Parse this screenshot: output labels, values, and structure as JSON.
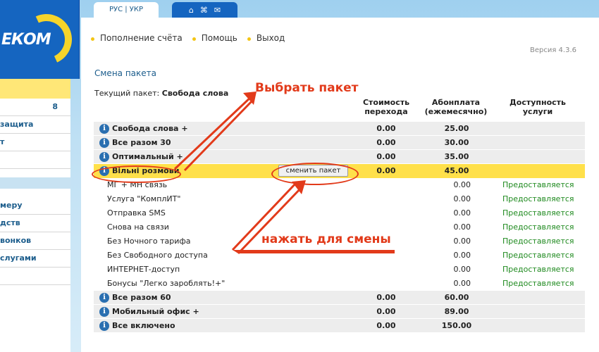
{
  "logo": {
    "text": "ЕКОМ"
  },
  "sidebar": {
    "items": [
      {
        "label": "",
        "num": "8"
      },
      {
        "label": "защита"
      },
      {
        "label": "т"
      },
      {
        "label": ""
      }
    ],
    "items2": [
      {
        "label": "меру"
      },
      {
        "label": "дств"
      },
      {
        "label": "вонков"
      },
      {
        "label": "слугами"
      },
      {
        "label": ""
      }
    ]
  },
  "lang": {
    "label": "РУС | УКР"
  },
  "nav": {
    "links": [
      "Пополнение счёта",
      "Помощь",
      "Выход"
    ],
    "version": "Версия 4.3.6"
  },
  "page": {
    "title": "Смена пакета",
    "current_label": "Текущий пакет:",
    "current_value": "Свобода слова"
  },
  "columns": {
    "cost": "Стоимость перехода",
    "fee": "Абонплата (ежемесячно)",
    "avail": "Доступность услуги"
  },
  "packages": [
    {
      "name": "Свобода слова +",
      "cost": "0.00",
      "fee": "25.00"
    },
    {
      "name": "Все разом 30",
      "cost": "0.00",
      "fee": "30.00"
    },
    {
      "name": "Оптимальный +",
      "cost": "0.00",
      "fee": "35.00"
    },
    {
      "name": "Вільні розмови",
      "cost": "0.00",
      "fee": "45.00",
      "button": "сменить пакет"
    }
  ],
  "services": [
    {
      "name": "МГ + МН связь",
      "fee": "0.00",
      "avail": "Предоставляется"
    },
    {
      "name": "Услуга \"КомплИТ\"",
      "fee": "0.00",
      "avail": "Предоставляется"
    },
    {
      "name": "Отправка SMS",
      "fee": "0.00",
      "avail": "Предоставляется"
    },
    {
      "name": "Снова на связи",
      "fee": "0.00",
      "avail": "Предоставляется"
    },
    {
      "name": "Без Ночного тарифа",
      "fee": "0.00",
      "avail": "Предоставляется"
    },
    {
      "name": "Без Свободного доступа",
      "fee": "0.00",
      "avail": "Предоставляется"
    },
    {
      "name": "ИНТЕРНЕТ-доступ",
      "fee": "0.00",
      "avail": "Предоставляется"
    },
    {
      "name": "Бонусы \"Легко зароблять!+\"",
      "fee": "0.00",
      "avail": "Предоставляется"
    }
  ],
  "packages2": [
    {
      "name": "Все разом 60",
      "cost": "0.00",
      "fee": "60.00"
    },
    {
      "name": "Мобильный офис +",
      "cost": "0.00",
      "fee": "89.00"
    },
    {
      "name": "Все включено",
      "cost": "0.00",
      "fee": "150.00"
    }
  ],
  "annotations": {
    "choose": "Выбрать пакет",
    "press": "нажать для смены"
  }
}
